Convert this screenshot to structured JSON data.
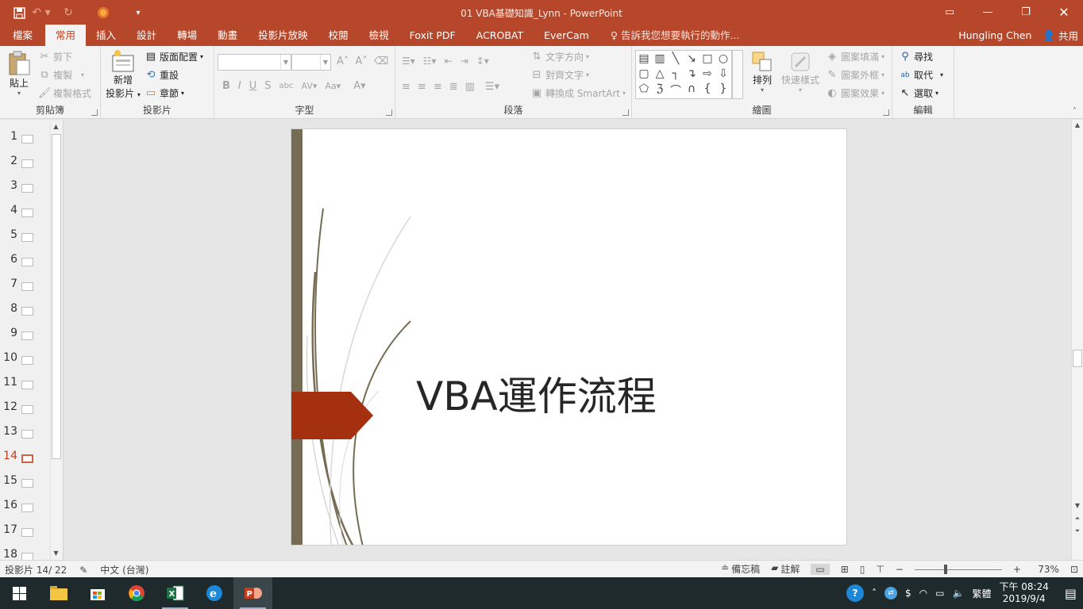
{
  "window": {
    "title": "01 VBA基礎知識_Lynn  -  PowerPoint",
    "qat": [
      "save-icon",
      "undo-icon",
      "redo-icon",
      "office-icon",
      "customize-icon"
    ]
  },
  "tabs": {
    "file": "檔案",
    "items": [
      "常用",
      "插入",
      "設計",
      "轉場",
      "動畫",
      "投影片放映",
      "校閱",
      "檢視",
      "Foxit PDF",
      "ACROBAT",
      "EverCam"
    ],
    "active": "常用",
    "tell_me": "告訴我您想要執行的動作...",
    "user": "Hungling Chen",
    "share": "共用"
  },
  "ribbon": {
    "clipboard": {
      "label": "剪貼簿",
      "paste": "貼上",
      "cut": "剪下",
      "copy": "複製",
      "format_painter": "複製格式"
    },
    "slides": {
      "label": "投影片",
      "new_slide_1": "新增",
      "new_slide_2": "投影片",
      "layout": "版面配置",
      "reset": "重設",
      "section": "章節"
    },
    "font": {
      "label": "字型",
      "font_name": "",
      "font_size": ""
    },
    "paragraph": {
      "label": "段落",
      "text_direction": "文字方向",
      "align_text": "對齊文字",
      "smartart": "轉換成 SmartArt"
    },
    "drawing": {
      "label": "繪圖",
      "arrange": "排列",
      "quick_styles": "快速樣式",
      "shape_fill": "圖案填滿",
      "shape_outline": "圖案外框",
      "shape_effects": "圖案效果"
    },
    "editing": {
      "label": "編輯",
      "find": "尋找",
      "replace": "取代",
      "select": "選取"
    }
  },
  "thumbnails": {
    "numbers": [
      "1",
      "2",
      "3",
      "4",
      "5",
      "6",
      "7",
      "8",
      "9",
      "10",
      "11",
      "12",
      "13",
      "14",
      "15",
      "16",
      "17",
      "18"
    ],
    "active": "14"
  },
  "slide": {
    "title": "VBA運作流程",
    "colors": {
      "band": "#756c53",
      "arrow": "#a5300f",
      "curves": "#756c53"
    }
  },
  "statusbar": {
    "slide_info": "投影片 14/ 22",
    "language": "中文 (台灣)",
    "notes": "備忘稿",
    "comments": "註解",
    "zoom": "73%",
    "zoom_level": 0.73
  },
  "taskbar": {
    "apps": [
      "windows-start-icon",
      "file-explorer-icon",
      "store-icon",
      "chrome-icon",
      "excel-icon",
      "edge-icon",
      "powerpoint-icon"
    ],
    "ime": "繁體",
    "time": "下午 08:24",
    "date": "2019/9/4"
  }
}
